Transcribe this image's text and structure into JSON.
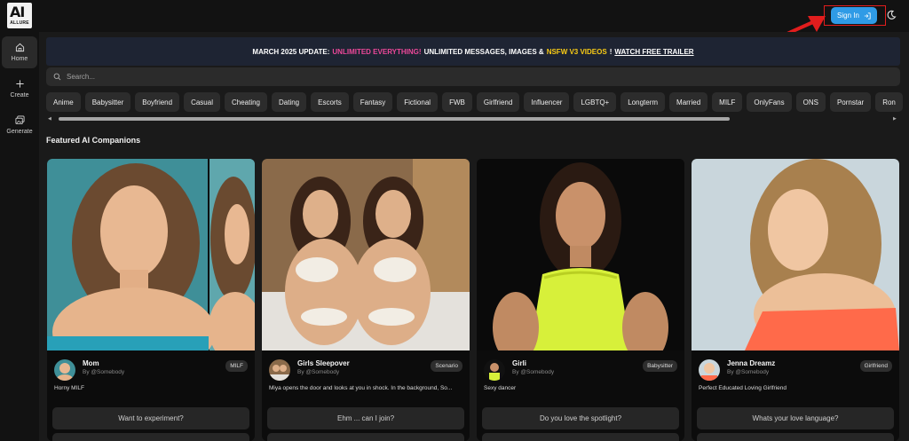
{
  "app": {
    "logo_text": "AI",
    "logo_subtext": "ALLURE"
  },
  "header": {
    "signin_label": "Sign In"
  },
  "sidebar": {
    "items": [
      {
        "label": "Home",
        "icon": "home-icon"
      },
      {
        "label": "Create",
        "icon": "plus-icon"
      },
      {
        "label": "Generate",
        "icon": "images-icon"
      }
    ]
  },
  "banner": {
    "part1": "MARCH 2025 UPDATE:",
    "part2": "UNLIMITED EVERYTHING!",
    "part3": "UNLIMITED MESSAGES, IMAGES &",
    "part4": "NSFW V3 VIDEOS",
    "part5": "!",
    "link": "WATCH FREE TRAILER"
  },
  "search": {
    "placeholder": "Search..."
  },
  "tags": [
    "Anime",
    "Babysitter",
    "Boyfriend",
    "Casual",
    "Cheating",
    "Dating",
    "Escorts",
    "Fantasy",
    "Fictional",
    "FWB",
    "Girlfriend",
    "Influencer",
    "LGBTQ+",
    "Longterm",
    "Married",
    "MILF",
    "OnlyFans",
    "ONS",
    "Pornstar",
    "Ron"
  ],
  "section": {
    "title": "Featured AI Companions"
  },
  "cards": [
    {
      "name": "Mom",
      "by": "By @Somebody",
      "badge": "MILF",
      "desc": "Horny MILF",
      "prompt": "Want to experiment?"
    },
    {
      "name": "Girls Sleepover",
      "by": "By @Somebody",
      "badge": "Scenario",
      "desc": "Miya opens the door and looks at you in shock. In the background, So...",
      "prompt": "Ehm ... can I join?"
    },
    {
      "name": "Girli",
      "by": "By @Somebody",
      "badge": "Babysitter",
      "desc": "Sexy dancer",
      "prompt": "Do you love the spotlight?"
    },
    {
      "name": "Jenna Dreamz",
      "by": "By @Somebody",
      "badge": "Girlfriend",
      "desc": "Perfect Educated Loving Girlfriend",
      "prompt": "Whats your love language?"
    }
  ],
  "colors": {
    "accent": "#2f9be6",
    "banner_pink": "#ec4899",
    "banner_gold": "#facc15",
    "highlight_red": "#e11d1d",
    "background": "#1a1a1a"
  }
}
